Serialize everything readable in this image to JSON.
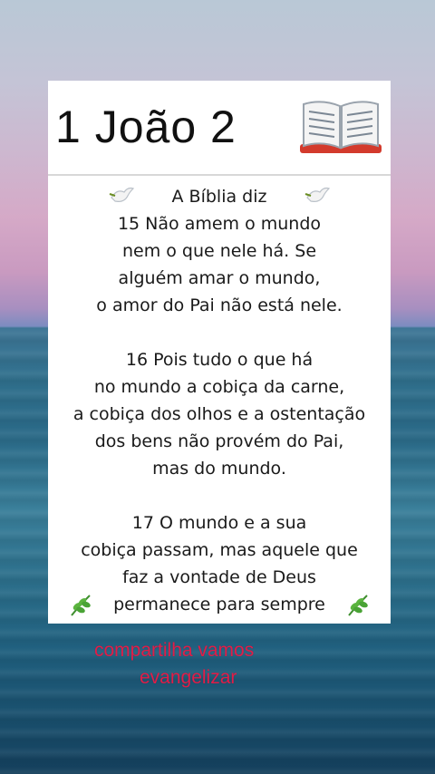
{
  "card": {
    "title": "1 João 2",
    "book_icon": "open-book-icon",
    "intro": "A Bíblia diz",
    "verses": [
      [
        "15 Não amem o mundo",
        "nem o que nele há. Se",
        "alguém amar o mundo,",
        "o amor do Pai não está nele."
      ],
      [
        "16 Pois tudo o que há",
        "no mundo a cobiça da carne,",
        "a cobiça dos olhos e a ostentação",
        "dos bens não provém do Pai,",
        "mas do mundo."
      ],
      [
        "17 O mundo e a sua",
        "cobiça passam, mas aquele que",
        "faz a vontade de Deus",
        "permanece para sempre"
      ]
    ]
  },
  "overlay": {
    "share_line1": "compartilha vamos",
    "share_line2": "evangelizar",
    "color": "#e11d48"
  }
}
